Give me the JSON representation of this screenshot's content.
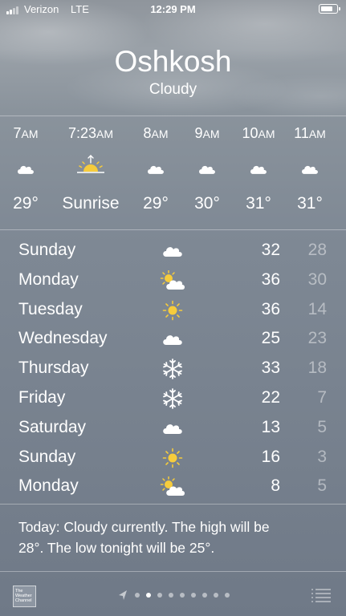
{
  "status_bar": {
    "carrier": "Verizon",
    "network": "LTE",
    "time": "12:29 PM",
    "battery_level": 0.85
  },
  "header": {
    "city": "Oshkosh",
    "condition": "Cloudy"
  },
  "hourly": [
    {
      "time": "7",
      "ampm": "AM",
      "icon": "cloud-icon",
      "temp": "29°"
    },
    {
      "time": "7:23",
      "ampm": "AM",
      "icon": "sunrise-icon",
      "temp": "Sunrise"
    },
    {
      "time": "8",
      "ampm": "AM",
      "icon": "cloud-icon",
      "temp": "29°"
    },
    {
      "time": "9",
      "ampm": "AM",
      "icon": "cloud-icon",
      "temp": "30°"
    },
    {
      "time": "10",
      "ampm": "AM",
      "icon": "cloud-icon",
      "temp": "31°"
    },
    {
      "time": "11",
      "ampm": "AM",
      "icon": "cloud-icon",
      "temp": "31°"
    }
  ],
  "daily": [
    {
      "day": "Sunday",
      "icon": "cloud-icon",
      "high": "32",
      "low": "28"
    },
    {
      "day": "Monday",
      "icon": "partly-sunny-icon",
      "high": "36",
      "low": "30"
    },
    {
      "day": "Tuesday",
      "icon": "sun-icon",
      "high": "36",
      "low": "14"
    },
    {
      "day": "Wednesday",
      "icon": "cloud-icon",
      "high": "25",
      "low": "23"
    },
    {
      "day": "Thursday",
      "icon": "snowflake-icon",
      "high": "33",
      "low": "18"
    },
    {
      "day": "Friday",
      "icon": "snowflake-icon",
      "high": "22",
      "low": "7"
    },
    {
      "day": "Saturday",
      "icon": "cloud-icon",
      "high": "13",
      "low": "5"
    },
    {
      "day": "Sunday",
      "icon": "sun-icon",
      "high": "16",
      "low": "3"
    },
    {
      "day": "Monday",
      "icon": "partly-sunny-icon",
      "high": "8",
      "low": "5"
    }
  ],
  "summary": {
    "line1": "Today: Cloudy currently. The high will be",
    "line2": "28°. The low tonight will be 25°."
  },
  "footer": {
    "logo_lines": [
      "The",
      "Weather",
      "Channel"
    ],
    "page_count": 9,
    "active_page": 1
  },
  "colors": {
    "sun": "#f6cc3c",
    "text": "#ffffff"
  }
}
